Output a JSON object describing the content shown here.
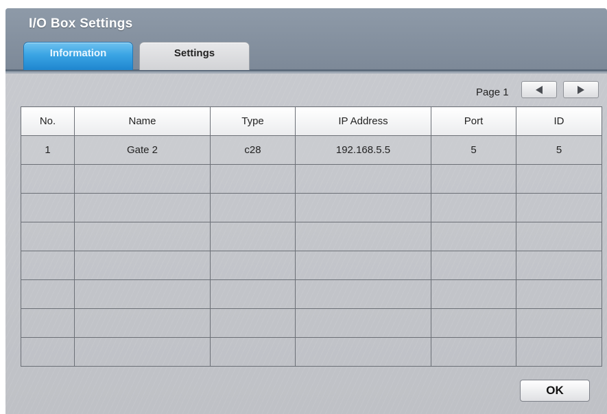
{
  "window": {
    "title": "I/O Box Settings"
  },
  "tabs": [
    {
      "label": "Information",
      "active": true
    },
    {
      "label": "Settings",
      "active": false
    }
  ],
  "pager": {
    "label": "Page 1",
    "prev_icon": "triangle-left-icon",
    "next_icon": "triangle-right-icon"
  },
  "table": {
    "columns": [
      "No.",
      "Name",
      "Type",
      "IP Address",
      "Port",
      "ID"
    ],
    "rows": [
      [
        "1",
        "Gate 2",
        "c28",
        "192.168.5.5",
        "5",
        "5"
      ],
      [
        "",
        "",
        "",
        "",
        "",
        ""
      ],
      [
        "",
        "",
        "",
        "",
        "",
        ""
      ],
      [
        "",
        "",
        "",
        "",
        "",
        ""
      ],
      [
        "",
        "",
        "",
        "",
        "",
        ""
      ],
      [
        "",
        "",
        "",
        "",
        "",
        ""
      ],
      [
        "",
        "",
        "",
        "",
        "",
        ""
      ],
      [
        "",
        "",
        "",
        "",
        "",
        ""
      ]
    ]
  },
  "footer": {
    "ok_label": "OK"
  },
  "colors": {
    "active_tab": "#3aa4e4",
    "titlebar": "#8e9aa8",
    "window_bg": "#c9cbd0"
  }
}
